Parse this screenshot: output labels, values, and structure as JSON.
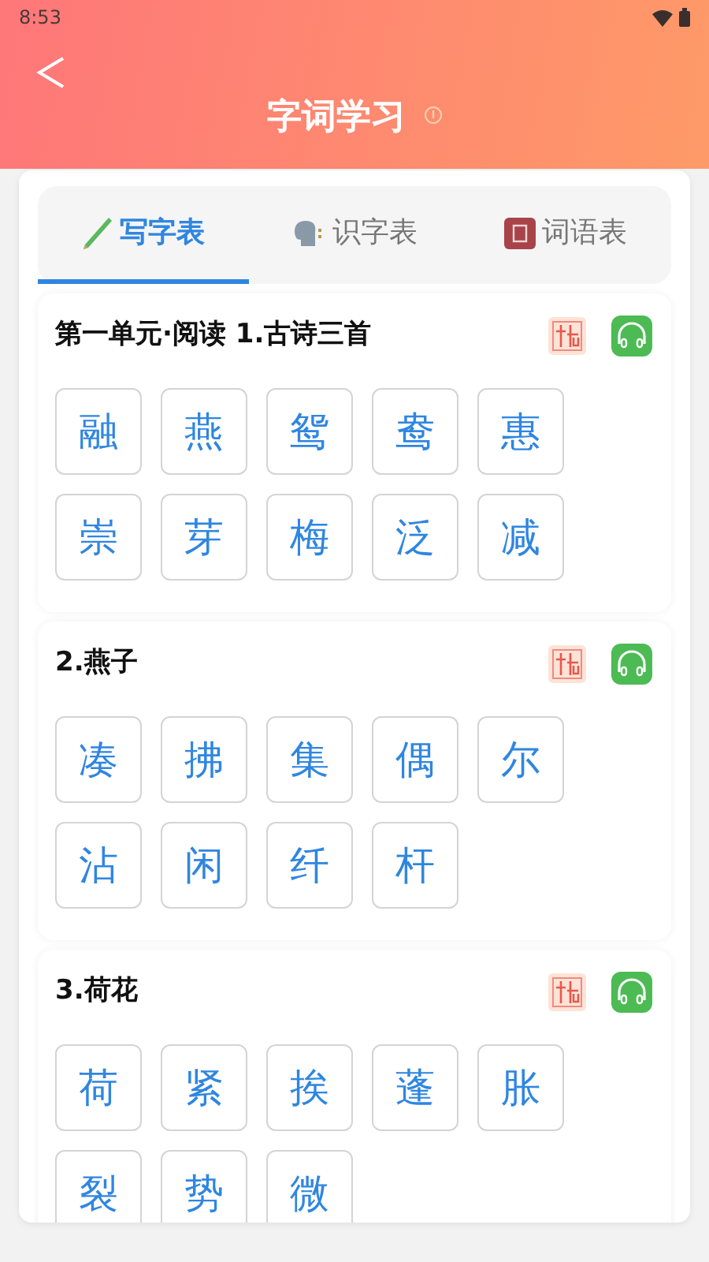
{
  "status_bar": {
    "time": "8:53"
  },
  "header": {
    "title": "字词学习"
  },
  "tabs": [
    {
      "label": "写字表",
      "selected": true
    },
    {
      "label": "识字表",
      "selected": false
    },
    {
      "label": "词语表",
      "selected": false
    }
  ],
  "lessons": [
    {
      "title": "第一单元·阅读 1.古诗三首",
      "characters": [
        "融",
        "燕",
        "鸳",
        "鸯",
        "惠",
        "崇",
        "芽",
        "梅",
        "泛",
        "减"
      ]
    },
    {
      "title": "2.燕子",
      "characters": [
        "凑",
        "拂",
        "集",
        "偶",
        "尔",
        "沾",
        "闲",
        "纤",
        "杆"
      ]
    },
    {
      "title": "3.荷花",
      "characters": [
        "荷",
        "紧",
        "挨",
        "蓬",
        "胀",
        "裂",
        "势",
        "微"
      ]
    }
  ]
}
